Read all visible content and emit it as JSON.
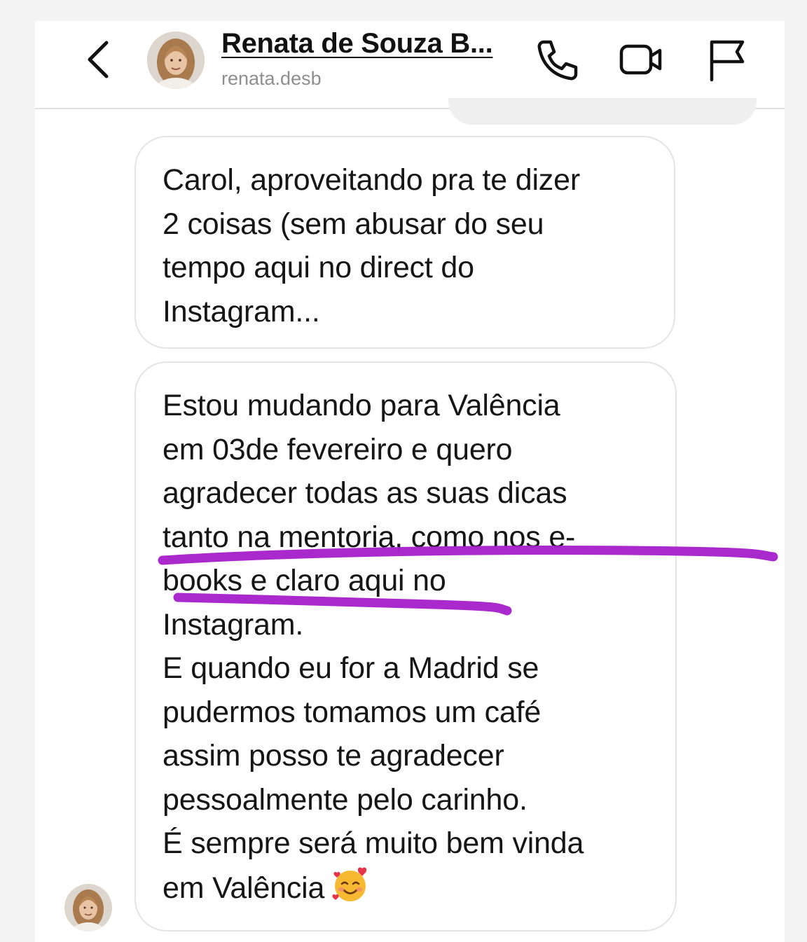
{
  "header": {
    "back_icon": "chevron-left-icon",
    "contact_name": "Renata de Souza B...",
    "username": "renata.desb",
    "actions": [
      {
        "name": "phone-call-button",
        "icon": "phone-icon"
      },
      {
        "name": "video-call-button",
        "icon": "video-camera-icon"
      },
      {
        "name": "report-button",
        "icon": "flag-icon"
      }
    ]
  },
  "conversation": {
    "messages": [
      {
        "lines": [
          "Carol, aproveitando pra te dizer",
          "2 coisas (sem abusar do seu",
          "tempo aqui no direct do",
          "Instagram..."
        ]
      },
      {
        "lines": [
          "Estou mudando para Valência",
          "em 03de fevereiro e quero",
          "agradecer todas as suas dicas",
          "tanto na mentoria, como nos e-",
          "books e claro aqui no",
          "Instagram.",
          "E quando eu for a Madrid se",
          "pudermos tomamos um café",
          "assim posso te agradecer",
          "pessoalmente pelo carinho.",
          "É sempre será muito bem vinda",
          "em Valência"
        ],
        "trailing_emoji": "smiling-face-with-hearts-icon"
      }
    ]
  },
  "annotation": {
    "highlight_color": "#a51ec9"
  }
}
